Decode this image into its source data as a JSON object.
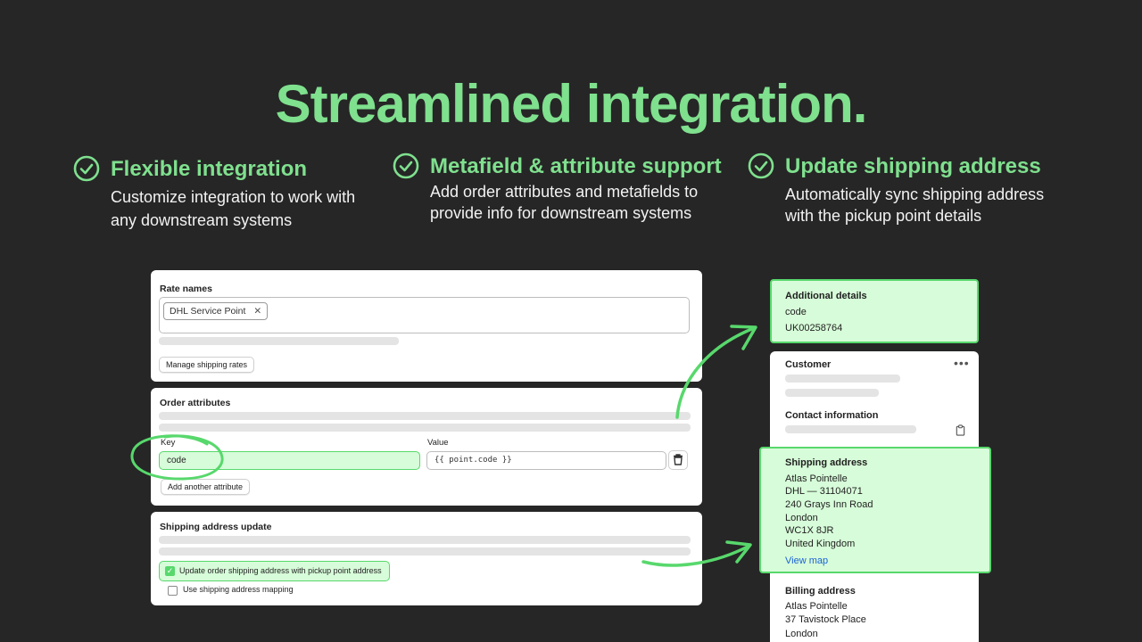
{
  "headline": "Streamlined integration.",
  "features": [
    {
      "title": "Flexible integration",
      "desc": "Customize integration to work with any downstream systems",
      "icon": "check-circle-icon"
    },
    {
      "title": "Metafield & attribute support",
      "desc": "Add order attributes and metafields to provide info for downstream systems",
      "icon": "check-circle-icon"
    },
    {
      "title": "Update shipping address",
      "desc": "Automatically sync shipping address with the pickup point details",
      "icon": "check-circle-icon"
    }
  ],
  "rate_names": {
    "title": "Rate names",
    "tag": "DHL Service Point",
    "manage_button": "Manage shipping rates"
  },
  "order_attributes": {
    "title": "Order attributes",
    "key_label": "Key",
    "key_value": "code",
    "value_label": "Value",
    "value_value": "{{ point.code }}",
    "add_button": "Add another attribute"
  },
  "shipping_update": {
    "title": "Shipping address update",
    "option1": "Update order shipping address with pickup point address",
    "option1_checked": true,
    "option2": "Use shipping address mapping",
    "option2_checked": false
  },
  "additional_details": {
    "title": "Additional details",
    "key": "code",
    "value": "UK00258764"
  },
  "customer": {
    "title": "Customer",
    "contact_title": "Contact information"
  },
  "shipping_address": {
    "title": "Shipping address",
    "lines": [
      "Atlas Pointelle",
      "DHL — 31104071",
      "240 Grays Inn Road",
      "London",
      "WC1X 8JR",
      "United Kingdom"
    ],
    "view_map": "View map"
  },
  "billing_address": {
    "title": "Billing address",
    "lines": [
      "Atlas Pointelle",
      "37 Tavistock Place",
      "London"
    ]
  },
  "colors": {
    "background": "#262626",
    "accent_green": "#7fe08e",
    "highlight_fill": "#d7fcd9",
    "highlight_border": "#58d86c",
    "link": "#1a62d6"
  }
}
